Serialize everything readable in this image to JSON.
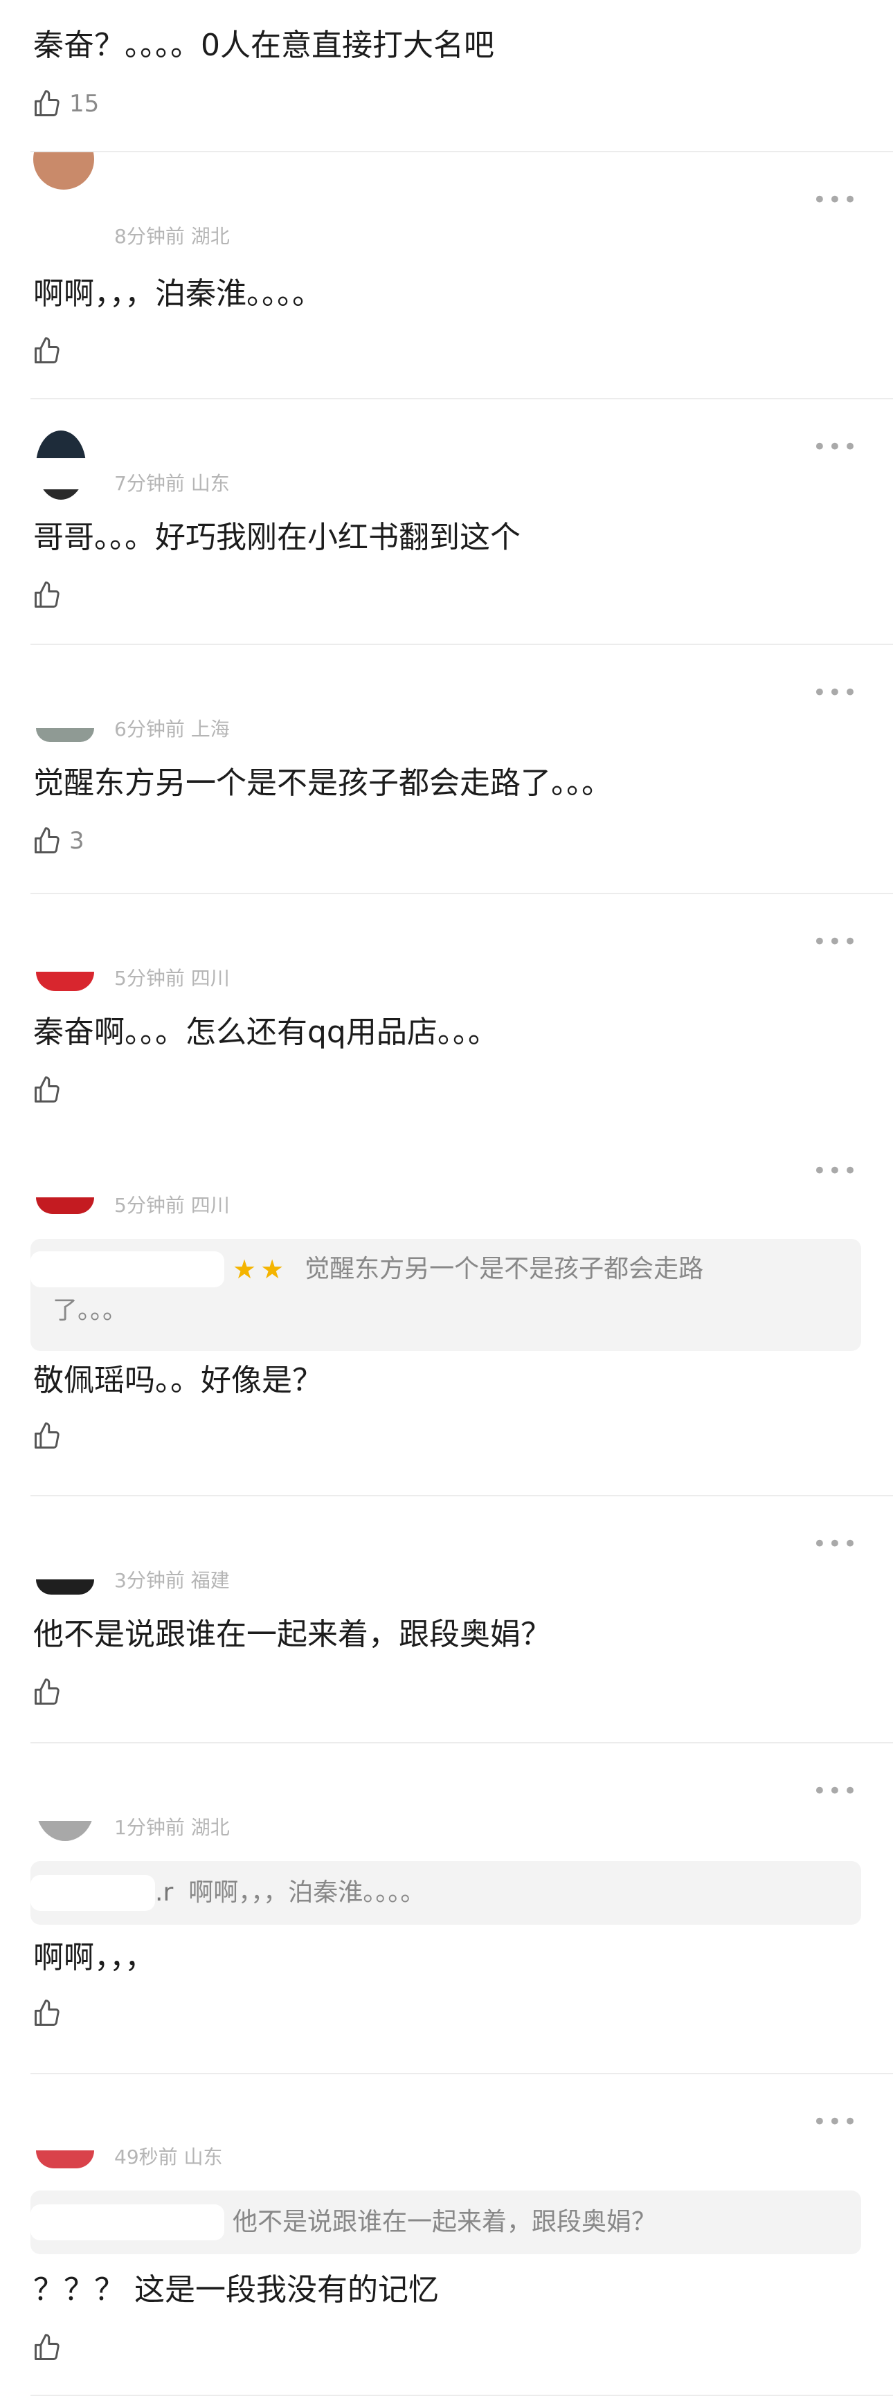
{
  "comments": [
    {
      "text": "秦奋？。。。。0人在意直接打大名吧",
      "likes": "15"
    },
    {
      "meta": "8分钟前 湖北",
      "text": "啊啊，，，泊秦淮。。。。",
      "likes": ""
    },
    {
      "meta": "7分钟前 山东",
      "text": "哥哥。。。好巧我刚在小红书翻到这个",
      "likes": ""
    },
    {
      "meta": "6分钟前 上海",
      "text": "觉醒东方另一个是不是孩子都会走路了。。。",
      "likes": "3"
    },
    {
      "meta": "5分钟前 四川",
      "text": "秦奋啊。。。怎么还有qq用品店。。。",
      "likes": ""
    },
    {
      "meta": "5分钟前 四川",
      "quote_line1": "觉醒东方另一个是不是孩子都会走路",
      "quote_line2": "了。。。",
      "text": "敬佩瑶吗。。好像是？",
      "likes": ""
    },
    {
      "meta": "3分钟前 福建",
      "text": "他不是说跟谁在一起来着，跟段奥娟？",
      "likes": ""
    },
    {
      "meta": "1分钟前 湖北",
      "quote_prefix": ".r",
      "quote_line1": "啊啊，，，泊秦淮。。。。",
      "text": "啊啊，，，",
      "likes": ""
    },
    {
      "meta": "49秒前 山东",
      "quote_line1": "他不是说跟谁在一起来着，跟段奥娟？",
      "text": "？？？ 这是一段我没有的记忆",
      "likes": ""
    }
  ],
  "more_label": "•••",
  "icons": {
    "like": "thumbs-up-icon",
    "more": "more-dots-icon",
    "star": "star-icon"
  },
  "colors": {
    "meta": "#b5b5b5",
    "divider": "#ececec",
    "quote_bg": "#f3f3f3",
    "star": "#f4b400"
  }
}
